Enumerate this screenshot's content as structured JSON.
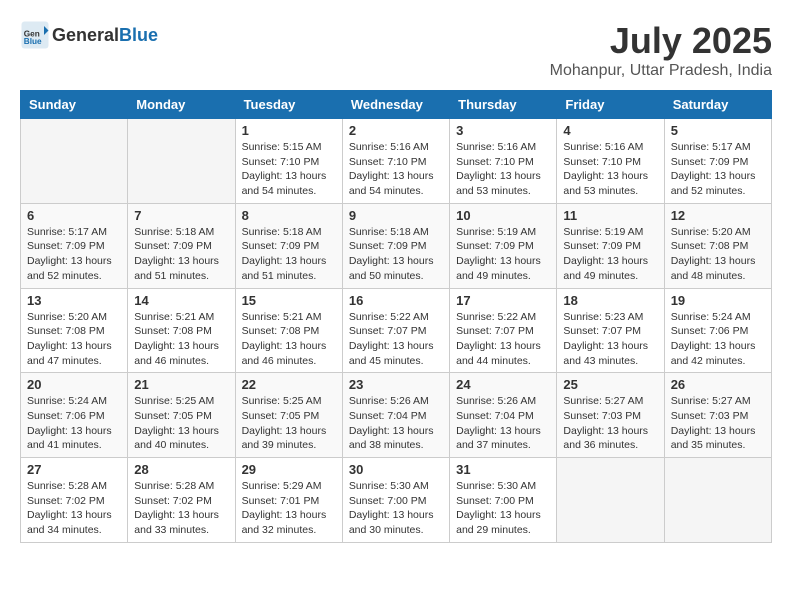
{
  "logo": {
    "general": "General",
    "blue": "Blue"
  },
  "title": {
    "month": "July 2025",
    "location": "Mohanpur, Uttar Pradesh, India"
  },
  "header_days": [
    "Sunday",
    "Monday",
    "Tuesday",
    "Wednesday",
    "Thursday",
    "Friday",
    "Saturday"
  ],
  "weeks": [
    [
      {
        "day": "",
        "info": ""
      },
      {
        "day": "",
        "info": ""
      },
      {
        "day": "1",
        "info": "Sunrise: 5:15 AM\nSunset: 7:10 PM\nDaylight: 13 hours and 54 minutes."
      },
      {
        "day": "2",
        "info": "Sunrise: 5:16 AM\nSunset: 7:10 PM\nDaylight: 13 hours and 54 minutes."
      },
      {
        "day": "3",
        "info": "Sunrise: 5:16 AM\nSunset: 7:10 PM\nDaylight: 13 hours and 53 minutes."
      },
      {
        "day": "4",
        "info": "Sunrise: 5:16 AM\nSunset: 7:10 PM\nDaylight: 13 hours and 53 minutes."
      },
      {
        "day": "5",
        "info": "Sunrise: 5:17 AM\nSunset: 7:09 PM\nDaylight: 13 hours and 52 minutes."
      }
    ],
    [
      {
        "day": "6",
        "info": "Sunrise: 5:17 AM\nSunset: 7:09 PM\nDaylight: 13 hours and 52 minutes."
      },
      {
        "day": "7",
        "info": "Sunrise: 5:18 AM\nSunset: 7:09 PM\nDaylight: 13 hours and 51 minutes."
      },
      {
        "day": "8",
        "info": "Sunrise: 5:18 AM\nSunset: 7:09 PM\nDaylight: 13 hours and 51 minutes."
      },
      {
        "day": "9",
        "info": "Sunrise: 5:18 AM\nSunset: 7:09 PM\nDaylight: 13 hours and 50 minutes."
      },
      {
        "day": "10",
        "info": "Sunrise: 5:19 AM\nSunset: 7:09 PM\nDaylight: 13 hours and 49 minutes."
      },
      {
        "day": "11",
        "info": "Sunrise: 5:19 AM\nSunset: 7:09 PM\nDaylight: 13 hours and 49 minutes."
      },
      {
        "day": "12",
        "info": "Sunrise: 5:20 AM\nSunset: 7:08 PM\nDaylight: 13 hours and 48 minutes."
      }
    ],
    [
      {
        "day": "13",
        "info": "Sunrise: 5:20 AM\nSunset: 7:08 PM\nDaylight: 13 hours and 47 minutes."
      },
      {
        "day": "14",
        "info": "Sunrise: 5:21 AM\nSunset: 7:08 PM\nDaylight: 13 hours and 46 minutes."
      },
      {
        "day": "15",
        "info": "Sunrise: 5:21 AM\nSunset: 7:08 PM\nDaylight: 13 hours and 46 minutes."
      },
      {
        "day": "16",
        "info": "Sunrise: 5:22 AM\nSunset: 7:07 PM\nDaylight: 13 hours and 45 minutes."
      },
      {
        "day": "17",
        "info": "Sunrise: 5:22 AM\nSunset: 7:07 PM\nDaylight: 13 hours and 44 minutes."
      },
      {
        "day": "18",
        "info": "Sunrise: 5:23 AM\nSunset: 7:07 PM\nDaylight: 13 hours and 43 minutes."
      },
      {
        "day": "19",
        "info": "Sunrise: 5:24 AM\nSunset: 7:06 PM\nDaylight: 13 hours and 42 minutes."
      }
    ],
    [
      {
        "day": "20",
        "info": "Sunrise: 5:24 AM\nSunset: 7:06 PM\nDaylight: 13 hours and 41 minutes."
      },
      {
        "day": "21",
        "info": "Sunrise: 5:25 AM\nSunset: 7:05 PM\nDaylight: 13 hours and 40 minutes."
      },
      {
        "day": "22",
        "info": "Sunrise: 5:25 AM\nSunset: 7:05 PM\nDaylight: 13 hours and 39 minutes."
      },
      {
        "day": "23",
        "info": "Sunrise: 5:26 AM\nSunset: 7:04 PM\nDaylight: 13 hours and 38 minutes."
      },
      {
        "day": "24",
        "info": "Sunrise: 5:26 AM\nSunset: 7:04 PM\nDaylight: 13 hours and 37 minutes."
      },
      {
        "day": "25",
        "info": "Sunrise: 5:27 AM\nSunset: 7:03 PM\nDaylight: 13 hours and 36 minutes."
      },
      {
        "day": "26",
        "info": "Sunrise: 5:27 AM\nSunset: 7:03 PM\nDaylight: 13 hours and 35 minutes."
      }
    ],
    [
      {
        "day": "27",
        "info": "Sunrise: 5:28 AM\nSunset: 7:02 PM\nDaylight: 13 hours and 34 minutes."
      },
      {
        "day": "28",
        "info": "Sunrise: 5:28 AM\nSunset: 7:02 PM\nDaylight: 13 hours and 33 minutes."
      },
      {
        "day": "29",
        "info": "Sunrise: 5:29 AM\nSunset: 7:01 PM\nDaylight: 13 hours and 32 minutes."
      },
      {
        "day": "30",
        "info": "Sunrise: 5:30 AM\nSunset: 7:00 PM\nDaylight: 13 hours and 30 minutes."
      },
      {
        "day": "31",
        "info": "Sunrise: 5:30 AM\nSunset: 7:00 PM\nDaylight: 13 hours and 29 minutes."
      },
      {
        "day": "",
        "info": ""
      },
      {
        "day": "",
        "info": ""
      }
    ]
  ]
}
